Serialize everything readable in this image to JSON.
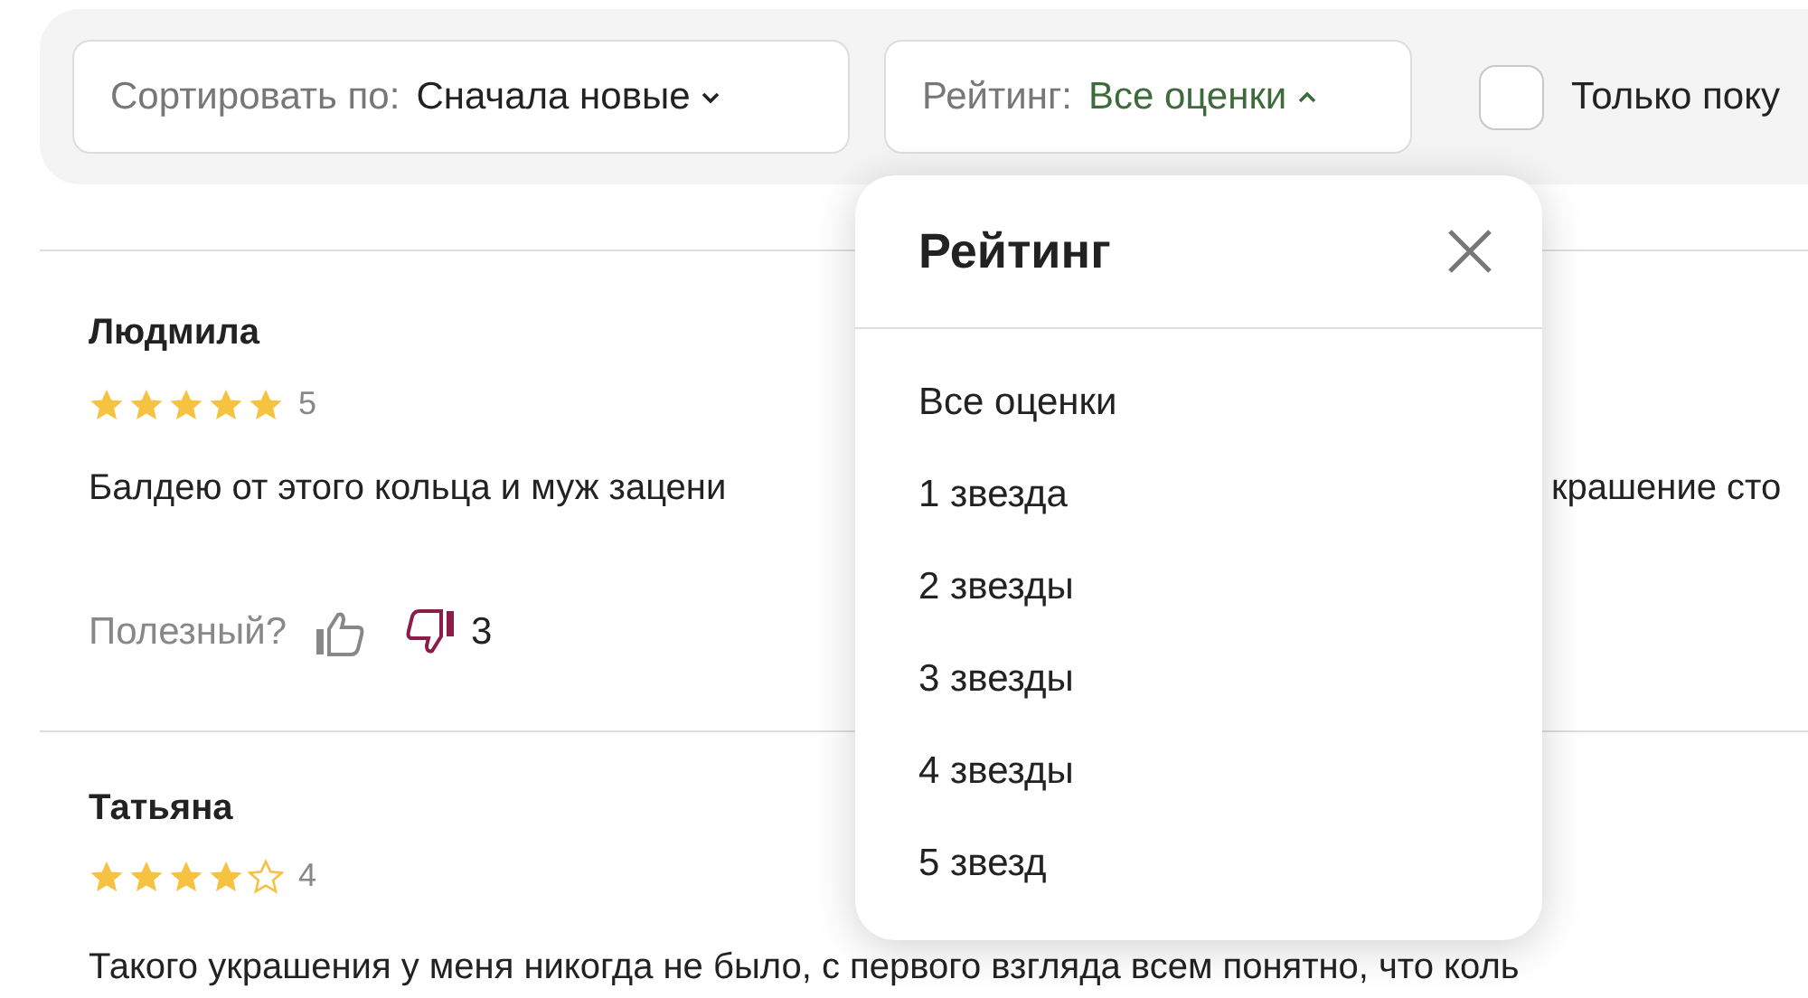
{
  "filters": {
    "sort": {
      "label": "Сортировать по:",
      "value": "Сначала новые"
    },
    "rating": {
      "label": "Рейтинг:",
      "value": "Все оценки",
      "expanded": true
    },
    "buyers_only": {
      "label": "Только поку",
      "checked": false
    }
  },
  "reviews": [
    {
      "author": "Людмила",
      "stars": 5,
      "rating_text": "5",
      "text_parts": [
        "Балдею от этого кольца и муж зацени",
        "крашение сто"
      ],
      "helpful_label": "Полезный?",
      "liked": false,
      "disliked": true,
      "dislike_count": "3"
    },
    {
      "author": "Татьяна",
      "stars": 4,
      "rating_text": "4",
      "text_parts": [
        "Такого украшения у меня никогда не было, с первого взгляда всем понятно, что коль"
      ]
    }
  ],
  "rating_popup": {
    "title": "Рейтинг",
    "options": [
      {
        "label": "Все оценки"
      },
      {
        "label": "1 звезда"
      },
      {
        "label": "2 звезды"
      },
      {
        "label": "3 звезды"
      },
      {
        "label": "4 звезды"
      },
      {
        "label": "5 звезд"
      }
    ]
  }
}
